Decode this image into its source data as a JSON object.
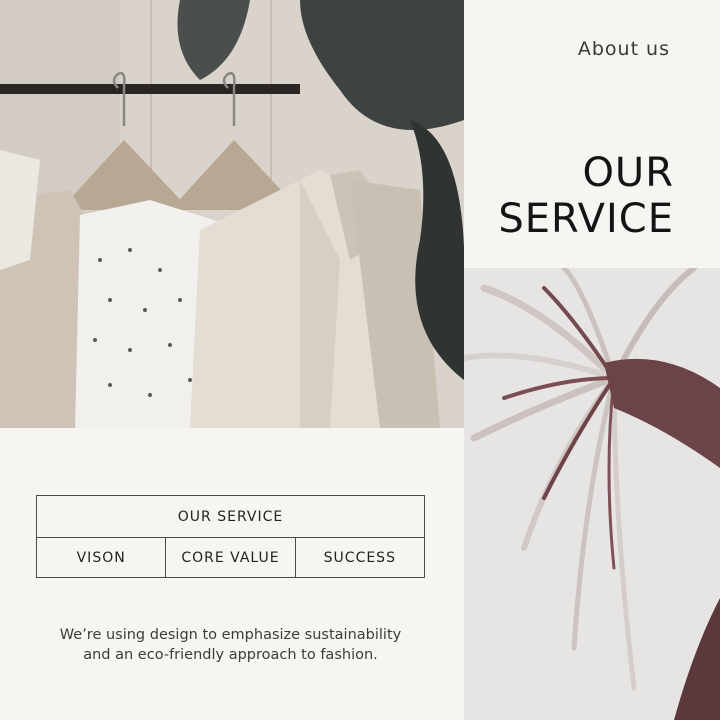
{
  "header": {
    "about_label": "About us"
  },
  "hero": {
    "title_line1": "OUR",
    "title_line2": "SERVICE"
  },
  "service_table": {
    "heading": "OUR SERVICE",
    "items": [
      "VISON",
      "CORE VALUE",
      "SUCCESS"
    ]
  },
  "tagline": {
    "line1": "We’re using design to emphasize sustainability",
    "line2": "and an eco-friendly approach to fashion."
  },
  "colors": {
    "background": "#f7f5f1",
    "text": "#141414",
    "border": "#4a4a4a"
  },
  "images": {
    "left": "clothes-rack-photo",
    "right": "flower-photo"
  }
}
